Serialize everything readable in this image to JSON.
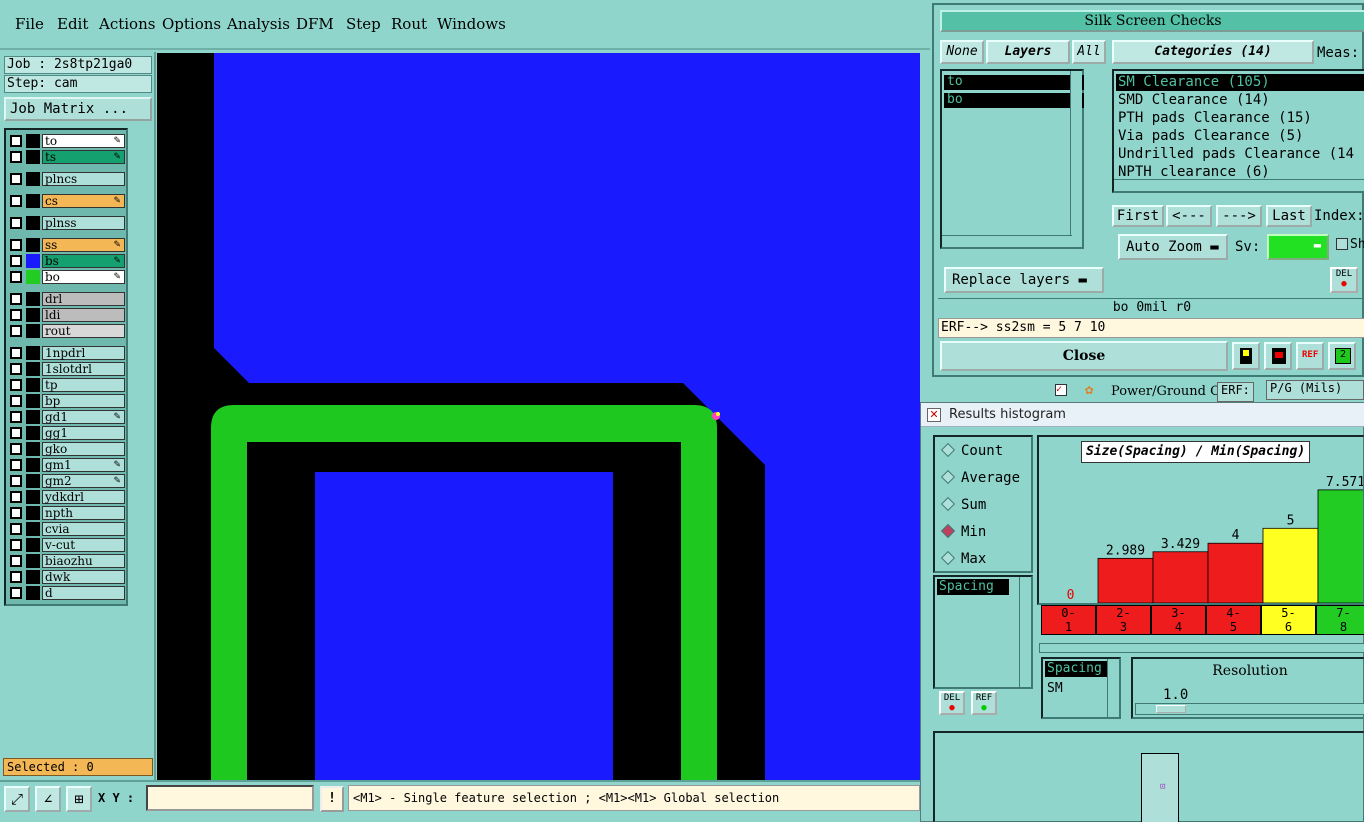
{
  "menu": [
    "File",
    "Edit",
    "Actions",
    "Options",
    "Analysis",
    "DFM",
    "Step",
    "Rout",
    "Windows"
  ],
  "job": {
    "job_label": "Job : 2s8tp21ga0",
    "step_label": "Step: cam",
    "matrix_button": "Job Matrix ..."
  },
  "layers": [
    {
      "name": "to",
      "color": "#ffffff",
      "swatch": "#000000",
      "edit": true
    },
    {
      "name": "ts",
      "color": "#15a070",
      "swatch": "#000000",
      "edit": true
    },
    {
      "name": "plncs",
      "color": "#aee0d9",
      "swatch": "#000000",
      "edit": false
    },
    {
      "name": "cs",
      "color": "#f4b755",
      "swatch": "#000000",
      "edit": true
    },
    {
      "name": "plnss",
      "color": "#aee0d9",
      "swatch": "#000000",
      "edit": false
    },
    {
      "name": "ss",
      "color": "#f4b755",
      "swatch": "#000000",
      "edit": true
    },
    {
      "name": "bs",
      "color": "#15a070",
      "swatch": "#1a1aff",
      "edit": true
    },
    {
      "name": "bo",
      "color": "#ffffff",
      "swatch": "#22cc22",
      "edit": true
    },
    {
      "name": "drl",
      "color": "#bcbcbc",
      "swatch": "#000000",
      "edit": false
    },
    {
      "name": "ldi",
      "color": "#bcbcbc",
      "swatch": "#000000",
      "edit": false
    },
    {
      "name": "rout",
      "color": "#d8d8d8",
      "swatch": "#000000",
      "edit": false
    },
    {
      "name": "1npdrl",
      "color": "#aee0d9",
      "swatch": "#000000",
      "edit": false
    },
    {
      "name": "1slotdrl",
      "color": "#aee0d9",
      "swatch": "#000000",
      "edit": false
    },
    {
      "name": "tp",
      "color": "#aee0d9",
      "swatch": "#000000",
      "edit": false
    },
    {
      "name": "bp",
      "color": "#aee0d9",
      "swatch": "#000000",
      "edit": false
    },
    {
      "name": "gd1",
      "color": "#aee0d9",
      "swatch": "#000000",
      "edit": true
    },
    {
      "name": "gg1",
      "color": "#aee0d9",
      "swatch": "#000000",
      "edit": false
    },
    {
      "name": "gko",
      "color": "#aee0d9",
      "swatch": "#000000",
      "edit": false
    },
    {
      "name": "gm1",
      "color": "#aee0d9",
      "swatch": "#000000",
      "edit": true
    },
    {
      "name": "gm2",
      "color": "#aee0d9",
      "swatch": "#000000",
      "edit": true
    },
    {
      "name": "ydkdrl",
      "color": "#aee0d9",
      "swatch": "#000000",
      "edit": false
    },
    {
      "name": "npth",
      "color": "#aee0d9",
      "swatch": "#000000",
      "edit": false
    },
    {
      "name": "cvia",
      "color": "#aee0d9",
      "swatch": "#000000",
      "edit": false
    },
    {
      "name": "v-cut",
      "color": "#aee0d9",
      "swatch": "#000000",
      "edit": false
    },
    {
      "name": "biaozhu",
      "color": "#aee0d9",
      "swatch": "#000000",
      "edit": false
    },
    {
      "name": "dwk",
      "color": "#aee0d9",
      "swatch": "#000000",
      "edit": false
    },
    {
      "name": "d",
      "color": "#aee0d9",
      "swatch": "#000000",
      "edit": false
    }
  ],
  "selected_label": "Selected : 0",
  "bottom": {
    "xy_label": "X Y :",
    "xy_value": "",
    "warn": "!",
    "status": "<M1> - Single feature selection ; <M1><M1> Global selection"
  },
  "silk": {
    "title": "Silk Screen Checks",
    "none_btn": "None",
    "layers_btn": "Layers",
    "all_btn": "All",
    "categories_btn": "Categories (14)",
    "meas_label": "Meas:",
    "layer_items": [
      "to",
      "bo"
    ],
    "categories": [
      {
        "label": "SM Clearance (105)",
        "selected": true
      },
      {
        "label": "SMD Clearance (14)",
        "selected": false
      },
      {
        "label": "PTH pads Clearance (15)",
        "selected": false
      },
      {
        "label": "Via pads Clearance (5)",
        "selected": false
      },
      {
        "label": "Undrilled pads Clearance (14",
        "selected": false
      },
      {
        "label": "NPTH clearance (6)",
        "selected": false
      }
    ],
    "nav": [
      "First",
      "<---",
      "--->",
      "Last"
    ],
    "index_label": "Index:",
    "auto_zoom": "Auto Zoom",
    "sv_label": "Sv:",
    "sh_label": "Sh",
    "replace_layers": "Replace layers",
    "bo_info": "bo  0mil  r0",
    "erf_line": "ERF--> ss2sm = 5 7 10",
    "close": "Close",
    "del_label": "DEL"
  },
  "behind": {
    "text": "Power/Ground C",
    "erf": "ERF:",
    "pg": "P/G (Mils)"
  },
  "hist": {
    "title": "Results histogram",
    "modes": [
      {
        "label": "Count",
        "on": false
      },
      {
        "label": "Average",
        "on": false
      },
      {
        "label": "Sum",
        "on": false
      },
      {
        "label": "Min",
        "on": true
      },
      {
        "label": "Max",
        "on": false
      }
    ],
    "list_item": "Spacing",
    "del_label": "DEL",
    "ref_label": "REF",
    "spacing_label": "Spacing",
    "sm_label": "SM",
    "resolution_label": "Resolution",
    "resolution_value": "1.0"
  },
  "chart_data": {
    "type": "bar",
    "title": "Size(Spacing) / Min(Spacing)",
    "categories": [
      "0-1",
      "2-3",
      "3-4",
      "4-5",
      "5-6",
      "7-8"
    ],
    "values": [
      0,
      2.989,
      3.429,
      4,
      5,
      7.571
    ],
    "colors": [
      "#ee1c1c",
      "#ee1c1c",
      "#ee1c1c",
      "#ee1c1c",
      "#ffff22",
      "#22cc22"
    ],
    "value_labels": [
      "0",
      "2.989",
      "3.429",
      "4",
      "5",
      "7.571"
    ]
  }
}
